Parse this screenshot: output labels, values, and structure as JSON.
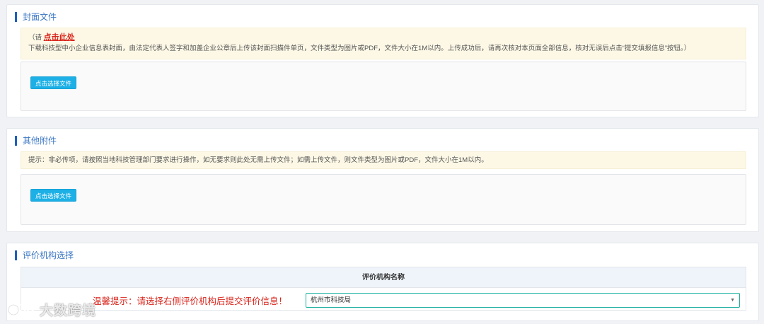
{
  "cover": {
    "title": "封面文件",
    "notice_prefix": "（请",
    "notice_link": "点击此处",
    "notice_text": "下载科技型中小企业信息表封面，由法定代表人签字和加盖企业公章后上传该封面扫描件单页，文件类型为图片或PDF，文件大小在1M以内。上传成功后，请再次核对本页面全部信息，核对无误后点击“提交填报信息”按钮。）",
    "button_label": "点击选择文件"
  },
  "attachments": {
    "title": "其他附件",
    "notice_text": "提示：非必传项，请按照当地科技管理部门要求进行操作，如无要求则此处无需上传文件；如需上传文件，则文件类型为图片或PDF，文件大小在1M以内。",
    "button_label": "点击选择文件"
  },
  "evaluator": {
    "title": "评价机构选择",
    "column_header": "评价机构名称",
    "warm_tip": "温馨提示：请选择右侧评价机构后提交评价信息！",
    "selected_value": "杭州市科技局",
    "select_arrow": "▼"
  },
  "watermark": {
    "text": "大数跨境"
  },
  "colors": {
    "accent_blue": "#1d5fbf",
    "button_cyan": "#1db0e6",
    "warning_red": "#d9261c",
    "notice_bg": "#fdf8e6"
  }
}
